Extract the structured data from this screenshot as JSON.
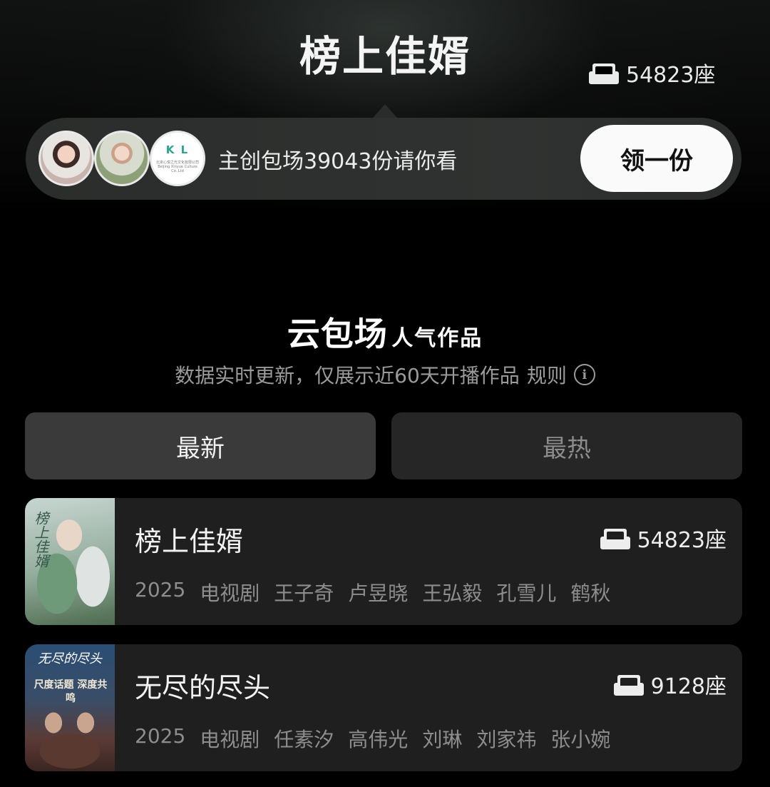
{
  "header": {
    "title": "榜上佳婿",
    "seats": "54823座",
    "seat_icon": "sofa-icon"
  },
  "invite": {
    "text": "主创包场39043份请你看",
    "button_label": "领一份",
    "logo_mark": "K L",
    "logo_text": "北京心悦之光文化有限公司 Beijing Xinyue Culture Co.,Ltd"
  },
  "section": {
    "title_big": "云包场",
    "title_small": "人气作品",
    "subtitle": "数据实时更新，仅展示近60天开播作品",
    "rules_label": "规则",
    "info_icon": "info-icon"
  },
  "tabs": [
    {
      "label": "最新",
      "active": true
    },
    {
      "label": "最热",
      "active": false
    }
  ],
  "works": [
    {
      "title": "榜上佳婿",
      "seats": "54823座",
      "poster_script": "榜上佳婿",
      "poster_text": "",
      "meta": [
        "2025",
        "电视剧",
        "王子奇",
        "卢昱晓",
        "王弘毅",
        "孔雪儿",
        "鹤秋"
      ]
    },
    {
      "title": "无尽的尽头",
      "seats": "9128座",
      "poster_script": "无尽的尽头",
      "poster_text": "尺度话题 深度共鸣",
      "meta": [
        "2025",
        "电视剧",
        "任素汐",
        "高伟光",
        "刘琳",
        "刘家祎",
        "张小婉"
      ]
    }
  ],
  "colors": {
    "background": "#000000",
    "card": "#1f1f1f",
    "tab_active": "#3a3a3a",
    "tab_inactive": "#262626",
    "button": "#fafafa"
  }
}
